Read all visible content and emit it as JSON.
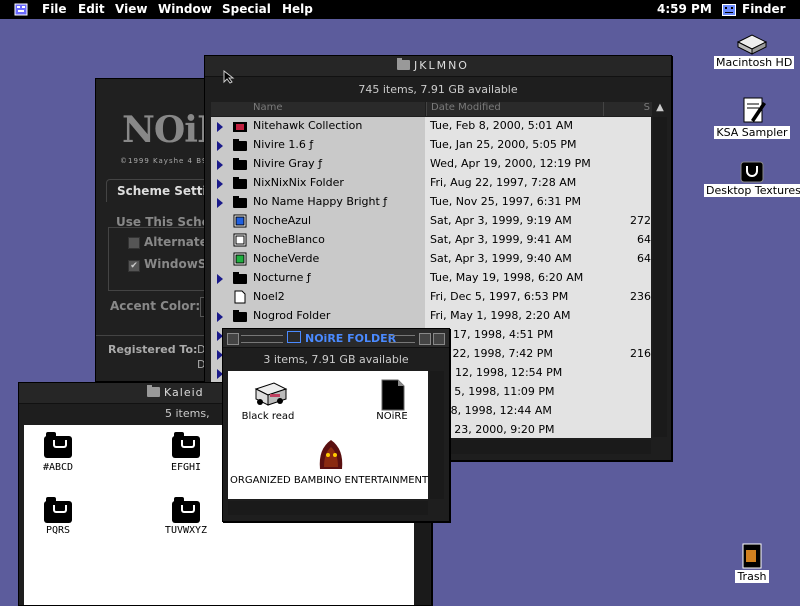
{
  "menubar": {
    "apple_icon": "apple-menu-icon",
    "items": [
      "File",
      "Edit",
      "View",
      "Window",
      "Special",
      "Help"
    ],
    "clock": "4:59 PM",
    "app_name": "Finder"
  },
  "desktop": {
    "icons": [
      {
        "label": "Macintosh HD",
        "icon": "hard-disk-icon"
      },
      {
        "label": "KSA Sampler",
        "icon": "document-icon"
      },
      {
        "label": "Desktop Textures",
        "icon": "folder-icon"
      },
      {
        "label": "Trash",
        "icon": "trash-icon"
      }
    ]
  },
  "noir_panel": {
    "logo": "NOiR",
    "subtitle": "©1999 Kayshe 4 B99",
    "tab": "Scheme Settin",
    "use_this": "Use This Schen",
    "option1": "Alternate",
    "option2": "WindowSl",
    "accent_label": "Accent Color:",
    "registered_label": "Registered To:",
    "registered_value1": "D",
    "registered_value2": "D"
  },
  "main_window": {
    "title": "JKLMNO",
    "info": "745 items, 7.91 GB available",
    "col_name": "Name",
    "col_date": "Date Modified",
    "col_size": "S",
    "rows": [
      {
        "name": "Nitehawk Collection",
        "date": "Tue, Feb 8, 2000, 5:01 AM",
        "size": "",
        "type": "folder-special"
      },
      {
        "name": "Nivire 1.6 ƒ",
        "date": "Tue, Jan 25, 2000, 5:05 PM",
        "size": "",
        "type": "folder"
      },
      {
        "name": "Nivire Gray ƒ",
        "date": "Wed, Apr 19, 2000, 12:19 PM",
        "size": "",
        "type": "folder"
      },
      {
        "name": "NixNixNix Folder",
        "date": "Fri, Aug 22, 1997, 7:28 AM",
        "size": "",
        "type": "folder"
      },
      {
        "name": "No Name Happy Bright ƒ",
        "date": "Tue, Nov 25, 1997, 6:31 PM",
        "size": "",
        "type": "folder"
      },
      {
        "name": "NocheAzul",
        "date": "Sat, Apr 3, 1999, 9:19 AM",
        "size": "272",
        "type": "file-blue"
      },
      {
        "name": "NocheBlanco",
        "date": "Sat, Apr 3, 1999, 9:41 AM",
        "size": "64",
        "type": "file-white"
      },
      {
        "name": "NocheVerde",
        "date": "Sat, Apr 3, 1999, 9:40 AM",
        "size": "64",
        "type": "file-green"
      },
      {
        "name": "Nocturne ƒ",
        "date": "Tue, May 19, 1998, 6:20 AM",
        "size": "",
        "type": "folder"
      },
      {
        "name": "Noel2",
        "date": "Fri, Dec 5, 1997, 6:53 PM",
        "size": "236",
        "type": "doc"
      },
      {
        "name": "Nogrod Folder",
        "date": "Fri, May 1, 1998, 2:20 AM",
        "size": "",
        "type": "folder"
      },
      {
        "name": "",
        "date": "Feb 17, 1998, 4:51 PM",
        "size": "",
        "type": "folder"
      },
      {
        "name": "",
        "date": "Oct 22, 1998, 7:42 PM",
        "size": "216",
        "type": "folder"
      },
      {
        "name": "",
        "date": "Aug 12, 1998, 12:54 PM",
        "size": "",
        "type": "folder"
      },
      {
        "name": "",
        "date": "Mar 5, 1998, 11:09 PM",
        "size": "",
        "type": "folder"
      },
      {
        "name": "",
        "date": "Jun 8, 1998, 12:44 AM",
        "size": "",
        "type": "folder"
      },
      {
        "name": "",
        "date": "Mar 23, 2000, 9:20 PM",
        "size": "",
        "type": "folder"
      }
    ]
  },
  "noire_window": {
    "title": "NOiRE FOLDER",
    "info": "3 items, 7.91 GB available",
    "items": [
      {
        "label": "Black read",
        "icon": "truck-icon"
      },
      {
        "label": "NOiRE",
        "icon": "document-icon"
      },
      {
        "label": "ORGANIZED BAMBINO ENTERTAINMENT",
        "icon": "hooded-figure-icon"
      }
    ]
  },
  "kaleid_window": {
    "title": "Kaleid",
    "info": "5 items,",
    "items": [
      {
        "label": "#ABCD"
      },
      {
        "label": "EFGHI"
      },
      {
        "label": "PQRS"
      },
      {
        "label": "TUVWXYZ"
      }
    ]
  },
  "colors": {
    "desktop": "#5c5c9c",
    "menubar": "#000000",
    "window_chrome": "#1e1e1e",
    "name_column": "#c9c9c9",
    "date_column": "#e3e3e3",
    "disclosure_triangle": "#1a1a8a",
    "active_title": "#3a6aff"
  }
}
